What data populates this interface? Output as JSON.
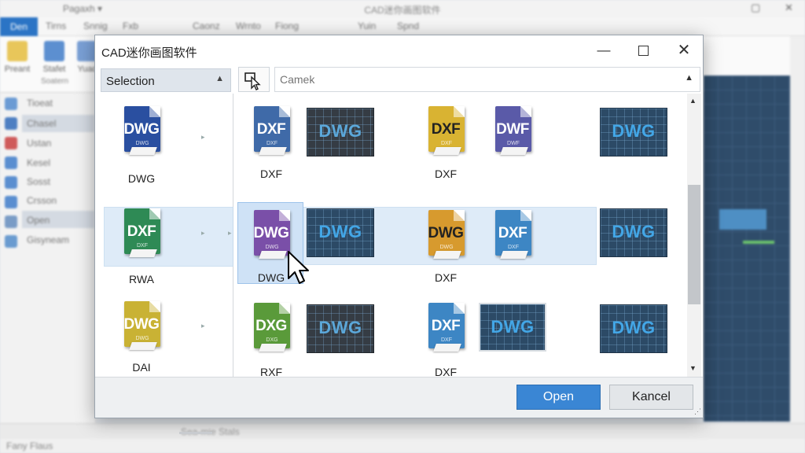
{
  "background_app": {
    "title": "CAD迷你画图软件",
    "quick_access": "Pagaxh ▾",
    "file_tab": "Den",
    "tabs": [
      "Tirns",
      "Snnig",
      "Fxb",
      "Caonz",
      "Wrnto",
      "Fiong",
      "Yuin",
      "Spnd"
    ],
    "tools": [
      "Preant",
      "Stafet",
      "Yuad"
    ],
    "tool_sub": "Soatern",
    "sidebar": [
      "Tioeat",
      "Chasel",
      "Ustan",
      "Kesel",
      "Sosst",
      "Crsson",
      "Open",
      "Gisyneam"
    ],
    "statusbar_left": "Fany Flaus",
    "statusbar_mid": "Sea-mie Stals"
  },
  "dialog": {
    "title": "CAD迷你画图软件",
    "minimize": "—",
    "close": "✕",
    "selection_label": "Selection",
    "search_placeholder": "Camek",
    "open_label": "Open",
    "cancel_label": "Kancel"
  },
  "left_items": [
    {
      "label": "DWG",
      "icon_text": "DWG",
      "color": "#2a4fa0"
    },
    {
      "label": "RWA",
      "icon_text": "DXF",
      "color": "#2e8a55"
    },
    {
      "label": "DAI",
      "icon_text": "DWG",
      "color": "#c9b234"
    }
  ],
  "grid_items": [
    {
      "label": "DXF",
      "icon_text": "DXF",
      "color": "#3f6aa8",
      "kind": "doc"
    },
    {
      "label": "",
      "icon_text": "DWG",
      "kind": "thumb-dark"
    },
    {
      "label": "DXF",
      "icon_text": "DXF",
      "color": "#d9b332",
      "kind": "doc"
    },
    {
      "label": "",
      "icon_text": "DWF",
      "color": "#5a5aa8",
      "kind": "doc"
    },
    {
      "label": "",
      "icon_text": "DWG",
      "kind": "thumb"
    },
    {
      "label": "DWG",
      "icon_text": "DWG",
      "color": "#7a4fa8",
      "kind": "doc"
    },
    {
      "label": "",
      "icon_text": "DWG",
      "kind": "thumb"
    },
    {
      "label": "DXF",
      "icon_text": "DWG",
      "color": "#d79a2e",
      "kind": "doc"
    },
    {
      "label": "",
      "icon_text": "DXF",
      "color": "#3d86c4",
      "kind": "doc"
    },
    {
      "label": "",
      "icon_text": "DWG",
      "kind": "thumb"
    },
    {
      "label": "RXF",
      "icon_text": "DXG",
      "color": "#5a9a3a",
      "kind": "doc"
    },
    {
      "label": "",
      "icon_text": "DWG",
      "kind": "thumb-dark"
    },
    {
      "label": "DXF",
      "icon_text": "DXF",
      "color": "#3d86c4",
      "kind": "doc"
    },
    {
      "label": "",
      "icon_text": "DWG",
      "kind": "thumb"
    },
    {
      "label": "",
      "icon_text": "DWG",
      "kind": "thumb"
    }
  ]
}
